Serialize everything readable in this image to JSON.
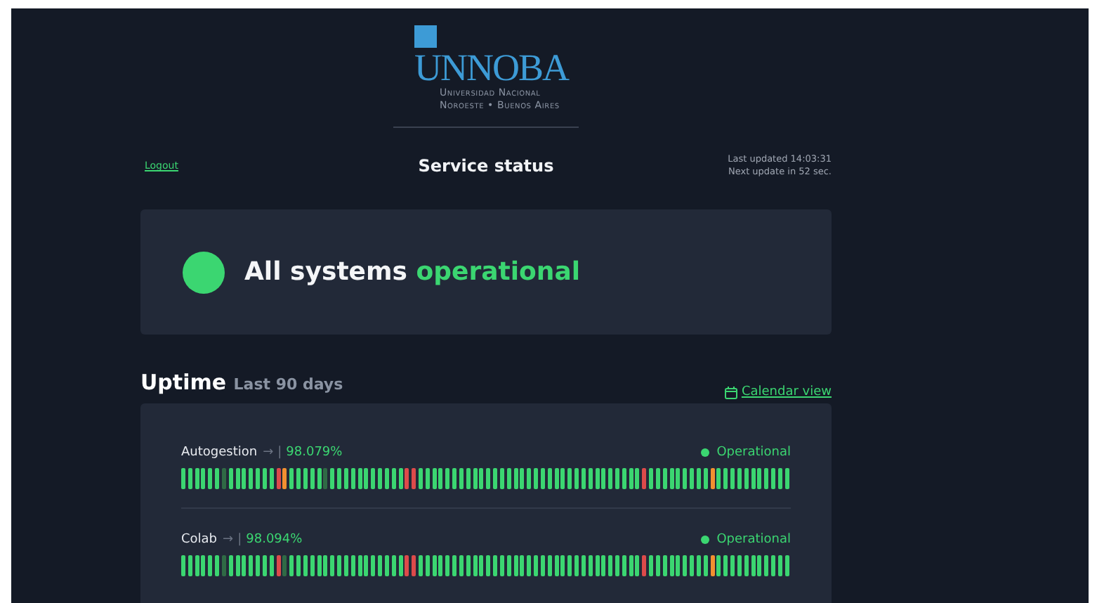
{
  "logo": {
    "name": "UNNOBA",
    "subtitle_1": "Universidad Nacional",
    "subtitle_2": "Noroeste • Buenos Aires"
  },
  "header": {
    "logout": "Logout",
    "title": "Service status",
    "last_updated": "Last updated 14:03:31",
    "next_update": "Next update in 52 sec."
  },
  "overall": {
    "prefix": "All systems",
    "status": "operational"
  },
  "uptime": {
    "title": "Uptime",
    "period": "Last 90 days",
    "calendar_link": "Calendar view"
  },
  "monitors": [
    {
      "name": "Autogestion",
      "arrow": "→",
      "separator": "|",
      "ratio": "98.079%",
      "status": "Operational",
      "days": [
        {
          "color": "#3bd671"
        },
        {
          "color": "#3bd671"
        },
        {
          "color": "#3bd671"
        },
        {
          "color": "#3bd671"
        },
        {
          "color": "#3bd671"
        },
        {
          "color": "#3bd671"
        },
        {
          "color": "#2f6a45"
        },
        {
          "color": "#3bd671"
        },
        {
          "color": "#3bd671"
        },
        {
          "color": "#3bd671"
        },
        {
          "color": "#3bd671"
        },
        {
          "color": "#3bd671"
        },
        {
          "color": "#3bd671"
        },
        {
          "color": "#3bd671"
        },
        {
          "color": "#dd4a4a"
        },
        {
          "color": "#f29030"
        },
        {
          "color": "#3bd671"
        },
        {
          "color": "#3bd671"
        },
        {
          "color": "#3bd671"
        },
        {
          "color": "#3bd671"
        },
        {
          "color": "#3bd671"
        },
        {
          "color": "#2f6a45"
        },
        {
          "color": "#3bd671"
        },
        {
          "color": "#3bd671"
        },
        {
          "color": "#3bd671"
        },
        {
          "color": "#3bd671"
        },
        {
          "color": "#3bd671"
        },
        {
          "color": "#3bd671"
        },
        {
          "color": "#3bd671"
        },
        {
          "color": "#3bd671"
        },
        {
          "color": "#3bd671"
        },
        {
          "color": "#3bd671"
        },
        {
          "color": "#3bd671"
        },
        {
          "color": "#dd4a4a"
        },
        {
          "color": "#dd4a4a"
        },
        {
          "color": "#3bd671"
        },
        {
          "color": "#3bd671"
        },
        {
          "color": "#3bd671"
        },
        {
          "color": "#3bd671"
        },
        {
          "color": "#3bd671"
        },
        {
          "color": "#3bd671"
        },
        {
          "color": "#3bd671"
        },
        {
          "color": "#3bd671"
        },
        {
          "color": "#3bd671"
        },
        {
          "color": "#3bd671"
        },
        {
          "color": "#3bd671"
        },
        {
          "color": "#3bd671"
        },
        {
          "color": "#3bd671"
        },
        {
          "color": "#3bd671"
        },
        {
          "color": "#3bd671"
        },
        {
          "color": "#3bd671"
        },
        {
          "color": "#3bd671"
        },
        {
          "color": "#3bd671"
        },
        {
          "color": "#3bd671"
        },
        {
          "color": "#3bd671"
        },
        {
          "color": "#3bd671"
        },
        {
          "color": "#3bd671"
        },
        {
          "color": "#3bd671"
        },
        {
          "color": "#3bd671"
        },
        {
          "color": "#3bd671"
        },
        {
          "color": "#3bd671"
        },
        {
          "color": "#3bd671"
        },
        {
          "color": "#3bd671"
        },
        {
          "color": "#3bd671"
        },
        {
          "color": "#3bd671"
        },
        {
          "color": "#3bd671"
        },
        {
          "color": "#3bd671"
        },
        {
          "color": "#3bd671"
        },
        {
          "color": "#dd4a4a"
        },
        {
          "color": "#3bd671"
        },
        {
          "color": "#3bd671"
        },
        {
          "color": "#3bd671"
        },
        {
          "color": "#3bd671"
        },
        {
          "color": "#3bd671"
        },
        {
          "color": "#3bd671"
        },
        {
          "color": "#3bd671"
        },
        {
          "color": "#3bd671"
        },
        {
          "color": "#3bd671"
        },
        {
          "color": "#f29030"
        },
        {
          "color": "#3bd671"
        },
        {
          "color": "#3bd671"
        },
        {
          "color": "#3bd671"
        },
        {
          "color": "#3bd671"
        },
        {
          "color": "#3bd671"
        },
        {
          "color": "#3bd671"
        },
        {
          "color": "#3bd671"
        },
        {
          "color": "#3bd671"
        },
        {
          "color": "#3bd671"
        },
        {
          "color": "#3bd671"
        },
        {
          "color": "#3bd671"
        }
      ]
    },
    {
      "name": "Colab",
      "arrow": "→",
      "separator": "|",
      "ratio": "98.094%",
      "status": "Operational",
      "days": [
        {
          "color": "#3bd671"
        },
        {
          "color": "#3bd671"
        },
        {
          "color": "#3bd671"
        },
        {
          "color": "#3bd671"
        },
        {
          "color": "#3bd671"
        },
        {
          "color": "#3bd671"
        },
        {
          "color": "#2f6a45"
        },
        {
          "color": "#3bd671"
        },
        {
          "color": "#3bd671"
        },
        {
          "color": "#3bd671"
        },
        {
          "color": "#3bd671"
        },
        {
          "color": "#3bd671"
        },
        {
          "color": "#3bd671"
        },
        {
          "color": "#3bd671"
        },
        {
          "color": "#dd4a4a"
        },
        {
          "color": "#2f6a45"
        },
        {
          "color": "#3bd671"
        },
        {
          "color": "#3bd671"
        },
        {
          "color": "#3bd671"
        },
        {
          "color": "#3bd671"
        },
        {
          "color": "#3bd671"
        },
        {
          "color": "#3bd671"
        },
        {
          "color": "#3bd671"
        },
        {
          "color": "#3bd671"
        },
        {
          "color": "#3bd671"
        },
        {
          "color": "#3bd671"
        },
        {
          "color": "#3bd671"
        },
        {
          "color": "#3bd671"
        },
        {
          "color": "#3bd671"
        },
        {
          "color": "#3bd671"
        },
        {
          "color": "#3bd671"
        },
        {
          "color": "#3bd671"
        },
        {
          "color": "#3bd671"
        },
        {
          "color": "#dd4a4a"
        },
        {
          "color": "#dd4a4a"
        },
        {
          "color": "#3bd671"
        },
        {
          "color": "#3bd671"
        },
        {
          "color": "#3bd671"
        },
        {
          "color": "#3bd671"
        },
        {
          "color": "#3bd671"
        },
        {
          "color": "#3bd671"
        },
        {
          "color": "#3bd671"
        },
        {
          "color": "#3bd671"
        },
        {
          "color": "#3bd671"
        },
        {
          "color": "#3bd671"
        },
        {
          "color": "#3bd671"
        },
        {
          "color": "#3bd671"
        },
        {
          "color": "#3bd671"
        },
        {
          "color": "#3bd671"
        },
        {
          "color": "#3bd671"
        },
        {
          "color": "#3bd671"
        },
        {
          "color": "#3bd671"
        },
        {
          "color": "#3bd671"
        },
        {
          "color": "#3bd671"
        },
        {
          "color": "#3bd671"
        },
        {
          "color": "#3bd671"
        },
        {
          "color": "#3bd671"
        },
        {
          "color": "#3bd671"
        },
        {
          "color": "#3bd671"
        },
        {
          "color": "#3bd671"
        },
        {
          "color": "#3bd671"
        },
        {
          "color": "#3bd671"
        },
        {
          "color": "#3bd671"
        },
        {
          "color": "#3bd671"
        },
        {
          "color": "#3bd671"
        },
        {
          "color": "#3bd671"
        },
        {
          "color": "#3bd671"
        },
        {
          "color": "#3bd671"
        },
        {
          "color": "#dd4a4a"
        },
        {
          "color": "#3bd671"
        },
        {
          "color": "#3bd671"
        },
        {
          "color": "#3bd671"
        },
        {
          "color": "#3bd671"
        },
        {
          "color": "#3bd671"
        },
        {
          "color": "#3bd671"
        },
        {
          "color": "#3bd671"
        },
        {
          "color": "#3bd671"
        },
        {
          "color": "#3bd671"
        },
        {
          "color": "#f29030"
        },
        {
          "color": "#3bd671"
        },
        {
          "color": "#3bd671"
        },
        {
          "color": "#3bd671"
        },
        {
          "color": "#3bd671"
        },
        {
          "color": "#3bd671"
        },
        {
          "color": "#3bd671"
        },
        {
          "color": "#3bd671"
        },
        {
          "color": "#3bd671"
        },
        {
          "color": "#3bd671"
        },
        {
          "color": "#3bd671"
        },
        {
          "color": "#3bd671"
        }
      ]
    }
  ]
}
